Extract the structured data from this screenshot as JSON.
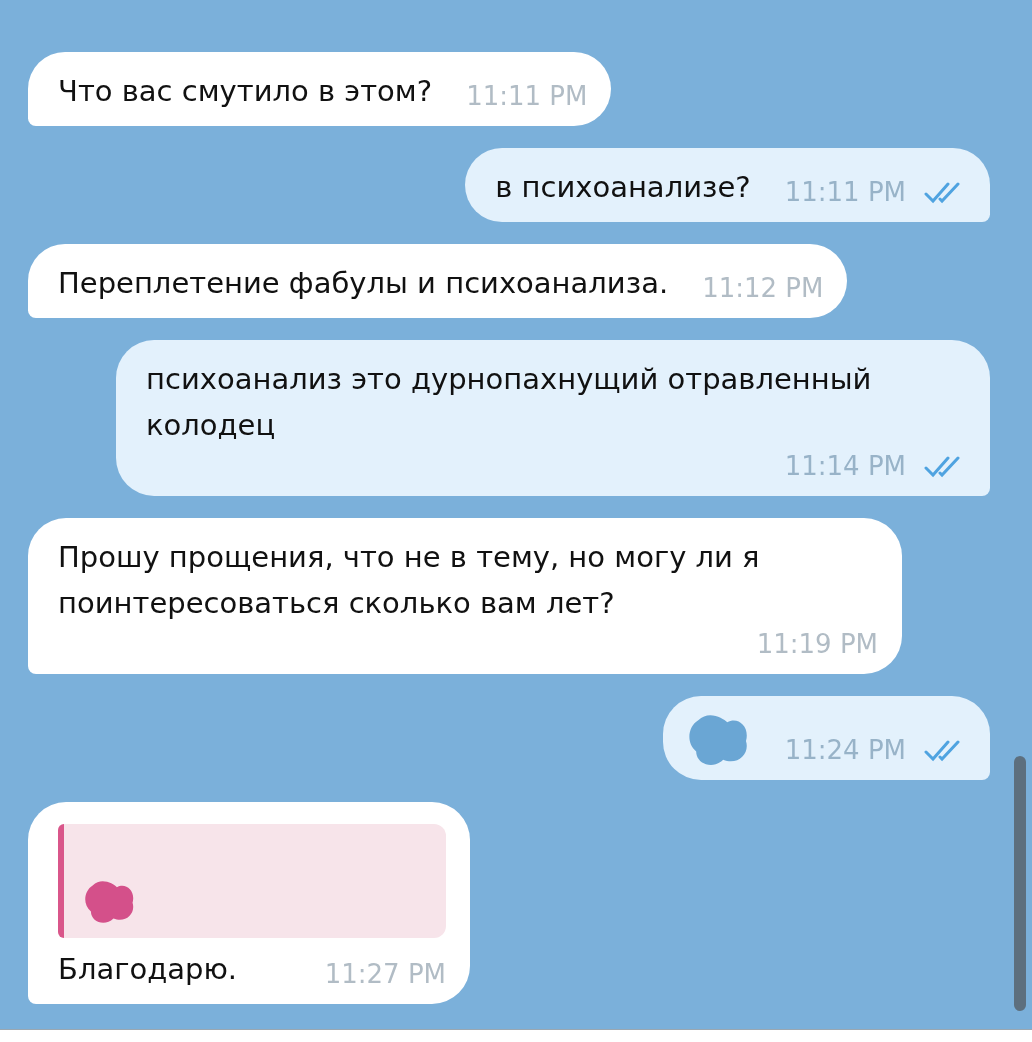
{
  "messages": [
    {
      "outgoing": false,
      "kind": "text",
      "text": "Что вас смутило в этом?",
      "time": "11:11 PM"
    },
    {
      "outgoing": true,
      "kind": "text",
      "text": "в психоанализе?",
      "time": "11:11 PM",
      "read": true
    },
    {
      "outgoing": false,
      "kind": "text",
      "text": "Переплетение фабулы и психоанализа.",
      "time": "11:12 PM"
    },
    {
      "outgoing": true,
      "kind": "text",
      "text": "психоанализ это дурнопахнущий отравленный колодец",
      "time": "11:14 PM",
      "read": true
    },
    {
      "outgoing": false,
      "kind": "text",
      "text": "Прошу прощения, что не в тему, но могу ли я поинтересоваться сколько вам лет?",
      "time": "11:19 PM"
    },
    {
      "outgoing": true,
      "kind": "scribble",
      "time": "11:24 PM",
      "read": true
    },
    {
      "outgoing": false,
      "kind": "text",
      "reply": {
        "kind": "scribble"
      },
      "text": "Благодарю.",
      "time": "11:27 PM"
    }
  ]
}
